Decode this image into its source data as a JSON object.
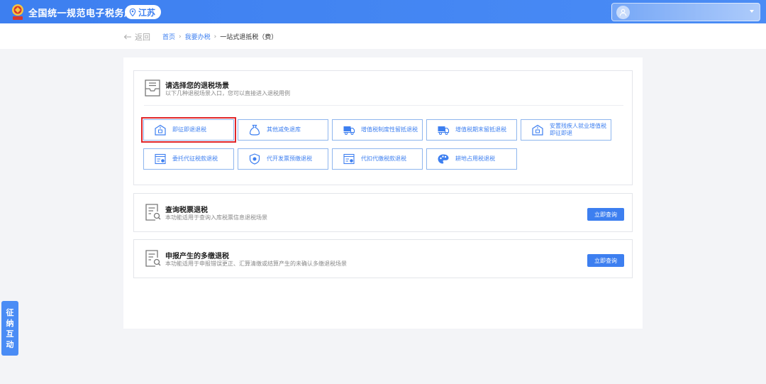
{
  "header": {
    "site_title": "全国统一规范电子税务局",
    "region": "江苏"
  },
  "breadcrumb": {
    "back_label": "返回",
    "items": [
      "首页",
      "我要办税",
      "一站式退抵税（费）"
    ]
  },
  "scenarios": {
    "title": "请选择您的退税场景",
    "description": "以下几种退税场景入口，您可以直接进入退税用例",
    "items": [
      {
        "label": "即征即退退税",
        "icon": "building-icon",
        "selected": true
      },
      {
        "label": "其他减免退库",
        "icon": "money-bag-icon",
        "selected": false
      },
      {
        "label": "增值税制度性留抵退税",
        "icon": "truck-icon",
        "selected": false
      },
      {
        "label": "增值税期末留抵退税",
        "icon": "truck-icon",
        "selected": false
      },
      {
        "label": "安置残疾人就业增值税即征即退",
        "icon": "building-icon",
        "selected": false
      },
      {
        "label": "委托代征税款退税",
        "icon": "bill-icon",
        "selected": false
      },
      {
        "label": "代开发票预缴退税",
        "icon": "shield-icon",
        "selected": false
      },
      {
        "label": "代扣代缴税款退税",
        "icon": "bill-icon",
        "selected": false
      },
      {
        "label": "耕地占用税退税",
        "icon": "palette-icon",
        "selected": false
      }
    ]
  },
  "query_card": {
    "title": "查询税票退税",
    "description": "本功能适用于查询入库税票信息退税场景",
    "button": "立即查询"
  },
  "declare_card": {
    "title": "申报产生的多缴退税",
    "description": "本功能适用于申报错误更正、汇算清缴或结算产生的未确认多缴退税场景",
    "button": "立即查询"
  },
  "side_tab": {
    "chars": [
      "征",
      "纳",
      "互",
      "动"
    ]
  },
  "colors": {
    "primary": "#3d7ff0",
    "selected_outline": "#e0262a",
    "tile_border": "#8fb6ee"
  }
}
